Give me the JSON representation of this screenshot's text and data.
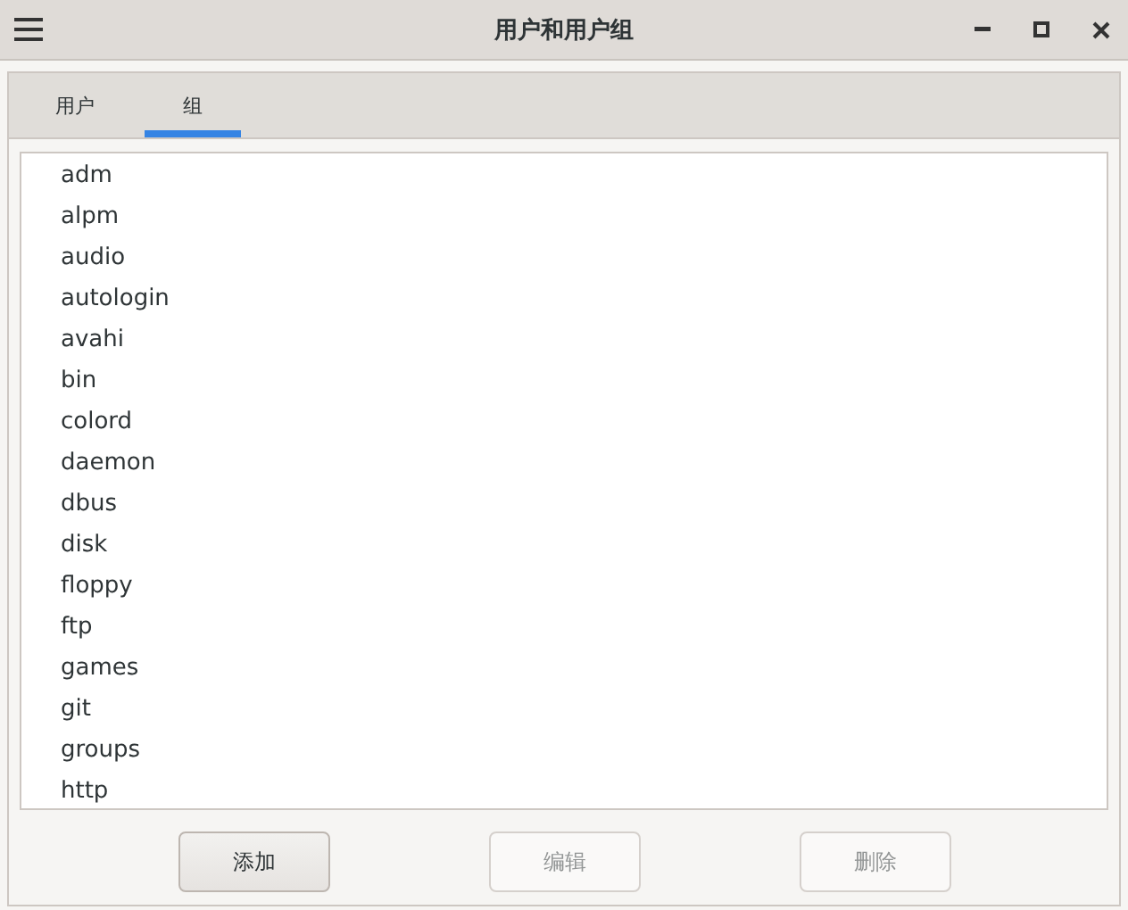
{
  "window": {
    "title": "用户和用户组"
  },
  "tabs": [
    {
      "label": "用户",
      "selected": false
    },
    {
      "label": "组",
      "selected": true
    }
  ],
  "groups": [
    "adm",
    "alpm",
    "audio",
    "autologin",
    "avahi",
    "bin",
    "colord",
    "daemon",
    "dbus",
    "disk",
    "floppy",
    "ftp",
    "games",
    "git",
    "groups",
    "http"
  ],
  "buttons": [
    {
      "label": "添加",
      "disabled": false
    },
    {
      "label": "编辑",
      "disabled": true
    },
    {
      "label": "删除",
      "disabled": true
    }
  ]
}
